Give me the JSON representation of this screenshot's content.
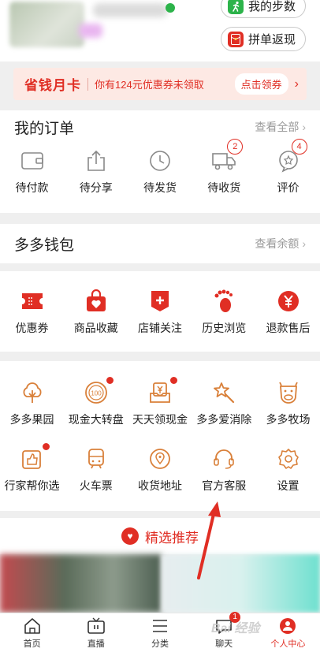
{
  "header": {
    "steps_label": "我的步数",
    "rebate_label": "拼单返现"
  },
  "promo": {
    "title": "省钱月卡",
    "desc": "你有124元优惠券未领取",
    "button": "点击领券",
    "arrow": "›"
  },
  "orders": {
    "title": "我的订单",
    "more": "查看全部",
    "items": [
      {
        "label": "待付款",
        "icon": "wallet-icon",
        "badge": ""
      },
      {
        "label": "待分享",
        "icon": "share-icon",
        "badge": ""
      },
      {
        "label": "待发货",
        "icon": "clock-icon",
        "badge": ""
      },
      {
        "label": "待收货",
        "icon": "truck-icon",
        "badge": "2"
      },
      {
        "label": "评价",
        "icon": "review-icon",
        "badge": "4"
      }
    ]
  },
  "wallet": {
    "title": "多多钱包",
    "more": "查看余额"
  },
  "shortcuts": {
    "items": [
      {
        "label": "优惠券",
        "icon": "coupon-icon"
      },
      {
        "label": "商品收藏",
        "icon": "favorite-bag-icon"
      },
      {
        "label": "店铺关注",
        "icon": "store-follow-icon"
      },
      {
        "label": "历史浏览",
        "icon": "footprint-icon"
      },
      {
        "label": "退款售后",
        "icon": "refund-icon"
      }
    ]
  },
  "services": {
    "row1": [
      {
        "label": "多多果园",
        "icon": "tree-icon",
        "dot": false
      },
      {
        "label": "现金大转盘",
        "icon": "wheel-icon",
        "dot": true,
        "inner_text": "100"
      },
      {
        "label": "天天领现金",
        "icon": "cash-icon",
        "dot": true
      },
      {
        "label": "多多爱消除",
        "icon": "star-wand-icon",
        "dot": false
      },
      {
        "label": "多多牧场",
        "icon": "cow-icon",
        "dot": false
      }
    ],
    "row2": [
      {
        "label": "行家帮你选",
        "icon": "thumbs-up-icon",
        "dot": true
      },
      {
        "label": "火车票",
        "icon": "train-icon",
        "dot": false
      },
      {
        "label": "收货地址",
        "icon": "location-icon",
        "dot": false
      },
      {
        "label": "官方客服",
        "icon": "headset-icon",
        "dot": false
      },
      {
        "label": "设置",
        "icon": "gear-icon",
        "dot": false
      }
    ]
  },
  "recommend": {
    "title": "精选推荐"
  },
  "tabbar": {
    "items": [
      {
        "label": "首页",
        "icon": "home-icon",
        "badge": "",
        "active": false
      },
      {
        "label": "直播",
        "icon": "tv-icon",
        "badge": "",
        "active": false
      },
      {
        "label": "分类",
        "icon": "list-icon",
        "badge": "",
        "active": false
      },
      {
        "label": "聊天",
        "icon": "chat-icon",
        "badge": "1",
        "active": false
      },
      {
        "label": "个人中心",
        "icon": "person-icon",
        "badge": "",
        "active": true
      }
    ]
  },
  "watermark": "Bai 经验",
  "colors": {
    "brand_red": "#e02e24",
    "icon_orange": "#d9803a",
    "gray_text": "#9a9a9a"
  }
}
